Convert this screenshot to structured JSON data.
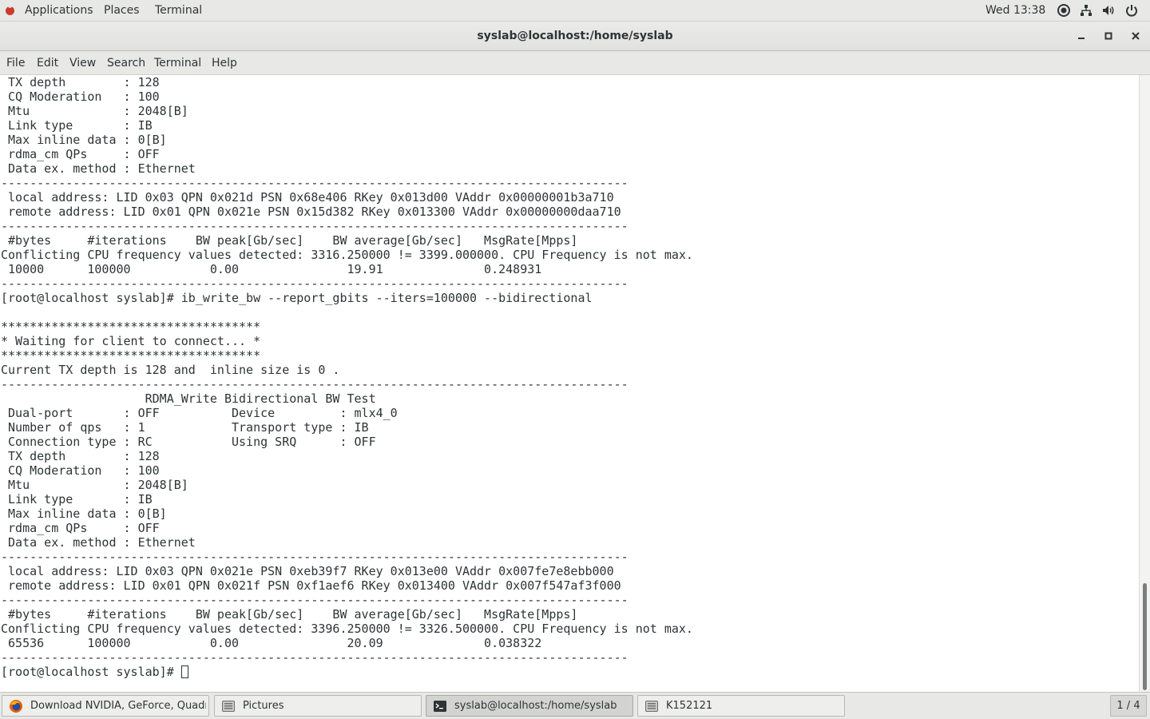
{
  "top_panel": {
    "applications": "Applications",
    "places": "Places",
    "terminal": "Terminal",
    "clock": "Wed 13:38",
    "tray_icons": [
      "accessibility-icon",
      "network-icon",
      "volume-icon",
      "power-icon"
    ]
  },
  "window": {
    "title": "syslab@localhost:/home/syslab"
  },
  "menu": {
    "file": "File",
    "edit": "Edit",
    "view": "View",
    "search": "Search",
    "terminal": "Terminal",
    "help": "Help"
  },
  "terminal": {
    "lines": [
      " TX depth        : 128",
      " CQ Moderation   : 100",
      " Mtu             : 2048[B]",
      " Link type       : IB",
      " Max inline data : 0[B]",
      " rdma_cm QPs     : OFF",
      " Data ex. method : Ethernet",
      "---------------------------------------------------------------------------------------",
      " local address: LID 0x03 QPN 0x021d PSN 0x68e406 RKey 0x013d00 VAddr 0x00000001b3a710",
      " remote address: LID 0x01 QPN 0x021e PSN 0x15d382 RKey 0x013300 VAddr 0x00000000daa710",
      "---------------------------------------------------------------------------------------",
      " #bytes     #iterations    BW peak[Gb/sec]    BW average[Gb/sec]   MsgRate[Mpps]",
      "Conflicting CPU frequency values detected: 3316.250000 != 3399.000000. CPU Frequency is not max.",
      " 10000      100000           0.00               19.91              0.248931",
      "---------------------------------------------------------------------------------------",
      "[root@localhost syslab]# ib_write_bw --report_gbits --iters=100000 --bidirectional",
      "",
      "************************************",
      "* Waiting for client to connect... *",
      "************************************",
      "Current TX depth is 128 and  inline size is 0 .",
      "---------------------------------------------------------------------------------------",
      "                    RDMA_Write Bidirectional BW Test",
      " Dual-port       : OFF          Device         : mlx4_0",
      " Number of qps   : 1            Transport type : IB",
      " Connection type : RC           Using SRQ      : OFF",
      " TX depth        : 128",
      " CQ Moderation   : 100",
      " Mtu             : 2048[B]",
      " Link type       : IB",
      " Max inline data : 0[B]",
      " rdma_cm QPs     : OFF",
      " Data ex. method : Ethernet",
      "---------------------------------------------------------------------------------------",
      " local address: LID 0x03 QPN 0x021e PSN 0xeb39f7 RKey 0x013e00 VAddr 0x007fe7e8ebb000",
      " remote address: LID 0x01 QPN 0x021f PSN 0xf1aef6 RKey 0x013400 VAddr 0x007f547af3f000",
      "---------------------------------------------------------------------------------------",
      " #bytes     #iterations    BW peak[Gb/sec]    BW average[Gb/sec]   MsgRate[Mpps]",
      "Conflicting CPU frequency values detected: 3396.250000 != 3326.500000. CPU Frequency is not max.",
      " 65536      100000           0.00               20.09              0.038322",
      "---------------------------------------------------------------------------------------"
    ],
    "prompt": "[root@localhost syslab]# "
  },
  "taskbar": {
    "tasks": [
      {
        "label": "Download NVIDIA, GeForce, Quadro...",
        "icon": "firefox-icon"
      },
      {
        "label": "Pictures",
        "icon": "file-manager-icon"
      },
      {
        "label": "syslab@localhost:/home/syslab",
        "icon": "terminal-icon"
      },
      {
        "label": "K152121",
        "icon": "file-manager-icon"
      }
    ],
    "workspace": "1 / 4"
  }
}
